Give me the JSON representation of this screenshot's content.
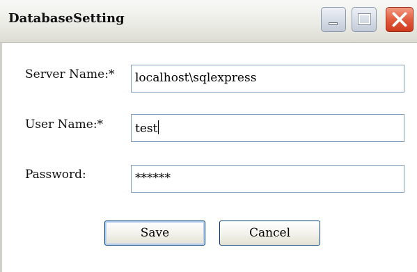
{
  "window": {
    "title": "DatabaseSetting",
    "controls": {
      "minimize": "minimize-icon",
      "maximize": "maximize-icon",
      "close": "close-icon"
    },
    "colors": {
      "close_accent": "#e0573a",
      "field_border": "#7f9db9",
      "button_border": "#003c74"
    }
  },
  "form": {
    "server": {
      "label": "Server Name:*",
      "value": "localhost\\sqlexpress"
    },
    "user": {
      "label": "User Name:*",
      "value": "test"
    },
    "password": {
      "label": "Password:",
      "value": "******"
    }
  },
  "buttons": {
    "save": "Save",
    "cancel": "Cancel"
  }
}
